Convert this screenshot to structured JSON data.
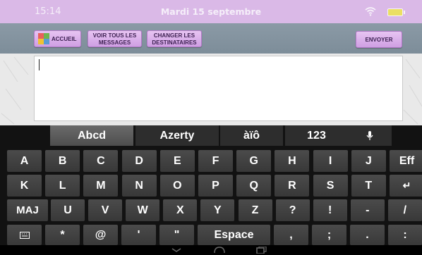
{
  "status_bar": {
    "time": "15:14",
    "date": "Mardi 15 septembre"
  },
  "toolbar": {
    "home_label": "ACCUEIL",
    "view_all_label": "VOIR TOUS LES\nMESSAGES",
    "change_recipients_label": "CHANGER LES\nDESTINATAIRES",
    "send_label": "ENVOYER"
  },
  "message": {
    "value": ""
  },
  "keyboard": {
    "layouts": [
      "Abcd",
      "Azerty",
      "àïô",
      "123"
    ],
    "selected_layout": "Abcd",
    "row1": [
      "A",
      "B",
      "C",
      "D",
      "E",
      "F",
      "G",
      "H",
      "I",
      "J",
      "Eff"
    ],
    "row2": [
      "K",
      "L",
      "M",
      "N",
      "O",
      "P",
      "Q",
      "R",
      "S",
      "T",
      "↵"
    ],
    "row3": [
      "MAJ",
      "U",
      "V",
      "W",
      "X",
      "Y",
      "Z",
      "?",
      "!",
      "-",
      "/"
    ],
    "row4": [
      "*",
      "@",
      "'",
      "\"",
      "Espace",
      ",",
      ";",
      ".",
      ":"
    ]
  },
  "icons": {
    "wifi": "wifi-icon",
    "battery": "battery-icon",
    "home_logo": "puzzle-logo-icon",
    "mic": "microphone-icon",
    "keyboard": "keyboard-icon",
    "nav_back": "chevron-down-icon",
    "nav_home": "home-icon",
    "nav_recents": "recent-apps-icon"
  },
  "colors": {
    "status_bar": "#dab9e7",
    "toolbar": "#8394a1",
    "button": "#d9aee9",
    "keyboard_bg": "#121212",
    "key": "#444444"
  }
}
